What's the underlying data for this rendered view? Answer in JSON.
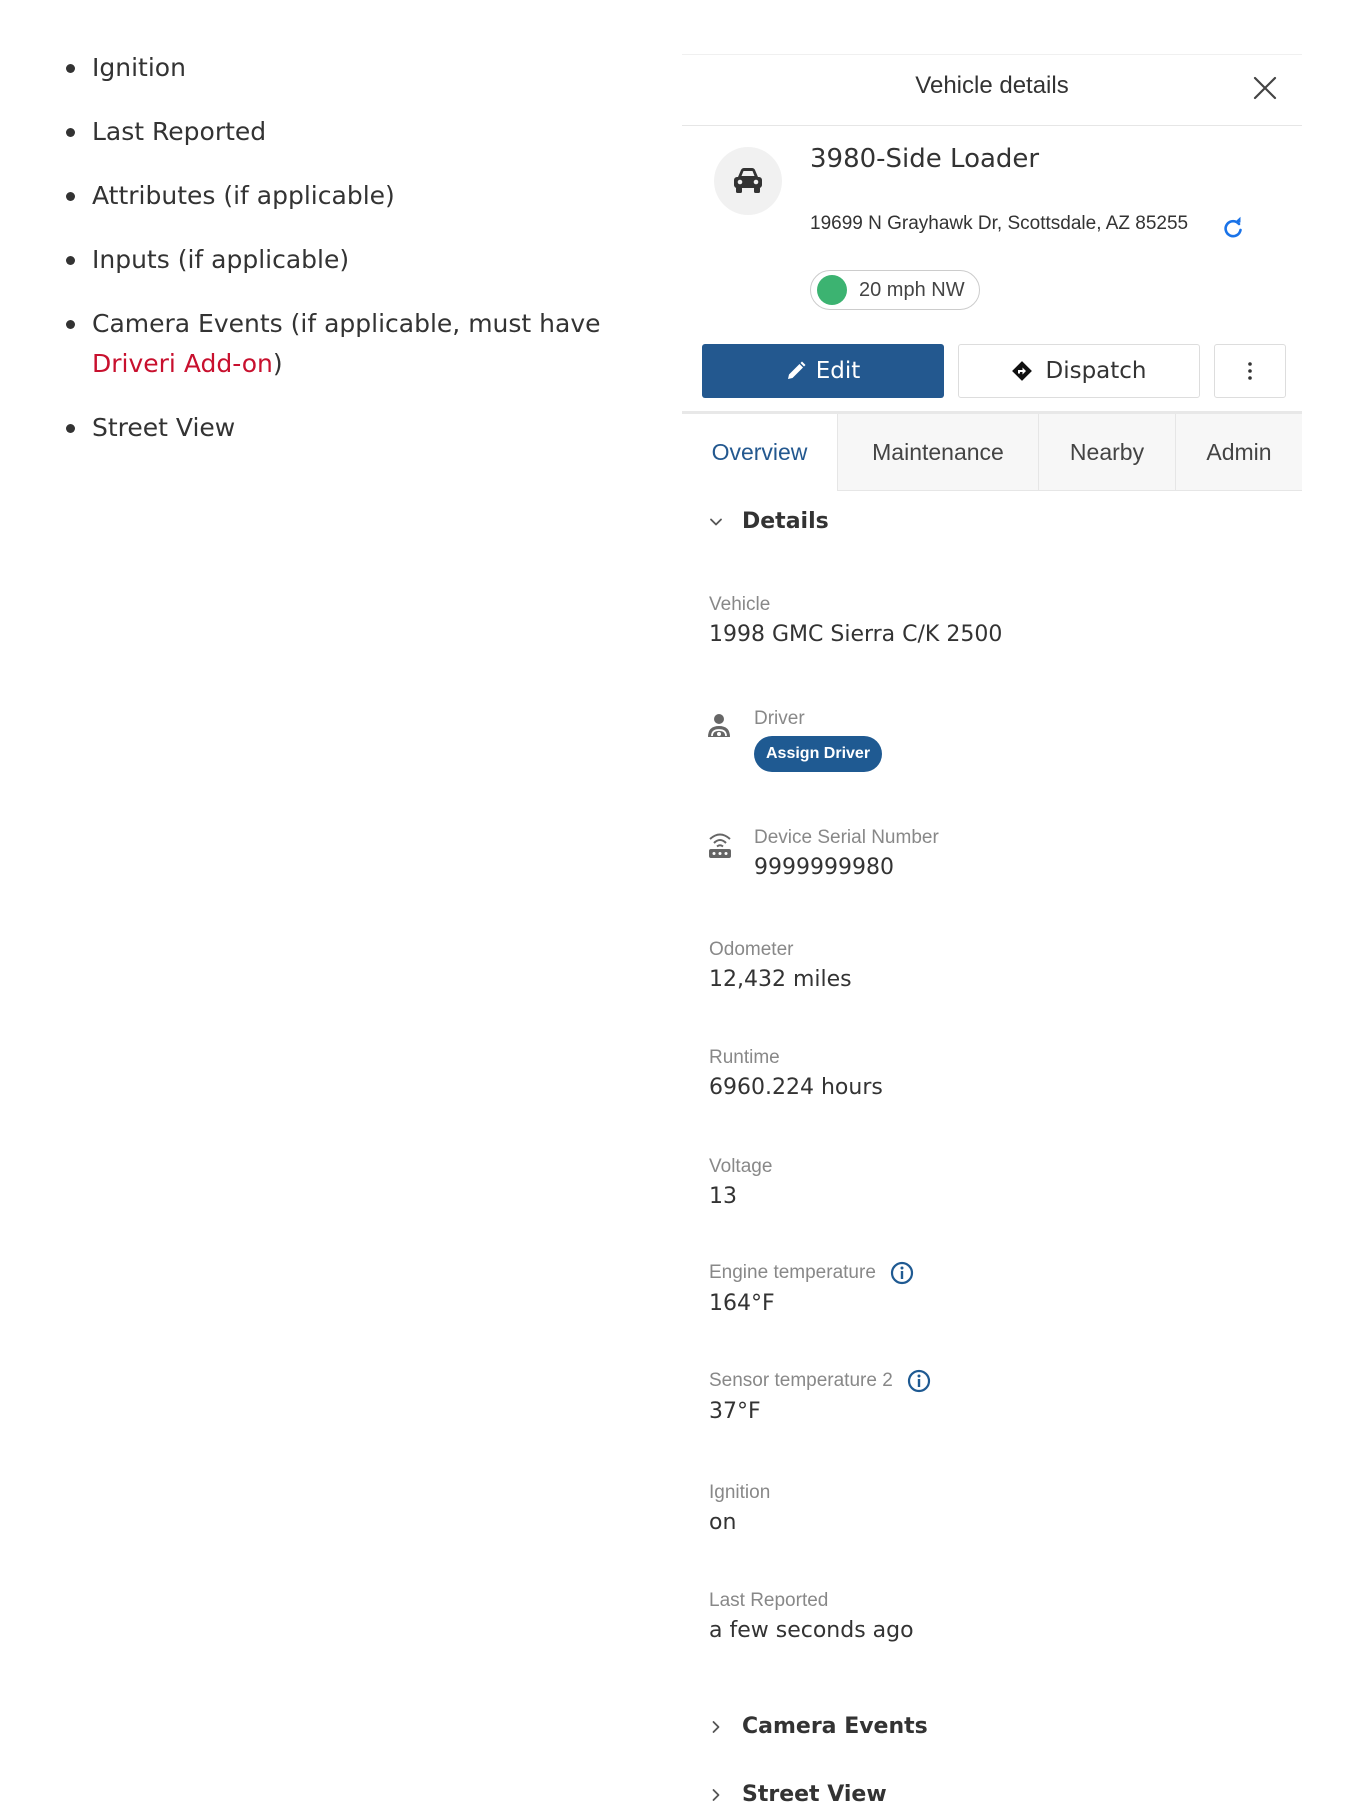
{
  "doc_list": {
    "items": [
      "Ignition",
      "Last Reported",
      "Attributes (if applicable)",
      "Inputs (if applicable)",
      "Street View"
    ],
    "camera_item": {
      "prefix": "Camera Events (if applicable, must have ",
      "link": "Driveri Add-on",
      "suffix": ")"
    }
  },
  "panel": {
    "title": "Vehicle details",
    "vehicle": {
      "name": "3980-Side Loader",
      "address": "19699 N Grayhawk Dr, Scottsdale, AZ 85255",
      "speed": "20 mph NW",
      "status_color": "#3cb371"
    },
    "actions": {
      "edit": "Edit",
      "dispatch": "Dispatch"
    },
    "tabs": [
      "Overview",
      "Maintenance",
      "Nearby",
      "Admin"
    ],
    "active_tab": "Overview",
    "sections": {
      "details": "Details",
      "camera_events": "Camera Events",
      "street_view": "Street View"
    },
    "fields": {
      "vehicle": {
        "label": "Vehicle",
        "value": "1998 GMC Sierra C/K 2500"
      },
      "driver": {
        "label": "Driver",
        "action": "Assign Driver"
      },
      "device": {
        "label": "Device Serial Number",
        "value": "9999999980"
      },
      "odometer": {
        "label": "Odometer",
        "value": "12,432 miles"
      },
      "runtime": {
        "label": "Runtime",
        "value": "6960.224 hours"
      },
      "voltage": {
        "label": "Voltage",
        "value": "13"
      },
      "engine_temp": {
        "label": "Engine temperature",
        "value": "164°F"
      },
      "sensor_temp": {
        "label": "Sensor temperature 2",
        "value": "37°F"
      },
      "ignition": {
        "label": "Ignition",
        "value": "on"
      },
      "last_reported": {
        "label": "Last Reported",
        "value": "a few seconds ago"
      }
    }
  },
  "colors": {
    "primary": "#23588f",
    "link_red": "#c8102e",
    "status_green": "#3cb371"
  }
}
